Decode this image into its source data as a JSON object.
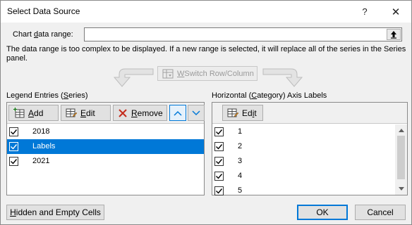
{
  "dialog": {
    "title": "Select Data Source",
    "help_glyph": "?",
    "close_glyph": "✕"
  },
  "range": {
    "label_pre": "Chart ",
    "label_mnemonic": "d",
    "label_post": "ata range:",
    "value": ""
  },
  "notice": "The data range is too complex to be displayed. If a new range is selected, it will replace all of the series in the Series panel.",
  "switch": {
    "mnemonic": "W",
    "label_rest": "Switch Row/Column"
  },
  "legend": {
    "label_pre": "Legend Entries (",
    "label_mnemonic": "S",
    "label_post": "eries)",
    "add_mnemonic": "A",
    "add_rest": "dd",
    "edit_mnemonic": "E",
    "edit_rest": "dit",
    "remove_mnemonic": "R",
    "remove_rest": "emove",
    "items": [
      {
        "label": "2018",
        "checked": true,
        "selected": false
      },
      {
        "label": "Labels",
        "checked": true,
        "selected": true
      },
      {
        "label": "2021",
        "checked": true,
        "selected": false
      }
    ]
  },
  "axis": {
    "label_pre": "Horizontal (",
    "label_mnemonic": "C",
    "label_post": "ategory) Axis Labels",
    "edit_pre": "Ed",
    "edit_mnemonic": "i",
    "edit_post": "t",
    "items": [
      {
        "label": "1",
        "checked": true
      },
      {
        "label": "2",
        "checked": true
      },
      {
        "label": "3",
        "checked": true
      },
      {
        "label": "4",
        "checked": true
      },
      {
        "label": "5",
        "checked": true
      }
    ]
  },
  "buttons": {
    "hidden_mnemonic": "H",
    "hidden_rest": "idden and Empty Cells",
    "ok": "OK",
    "cancel": "Cancel"
  },
  "colors": {
    "accent": "#0078d7",
    "remove_red": "#c42b1c"
  }
}
